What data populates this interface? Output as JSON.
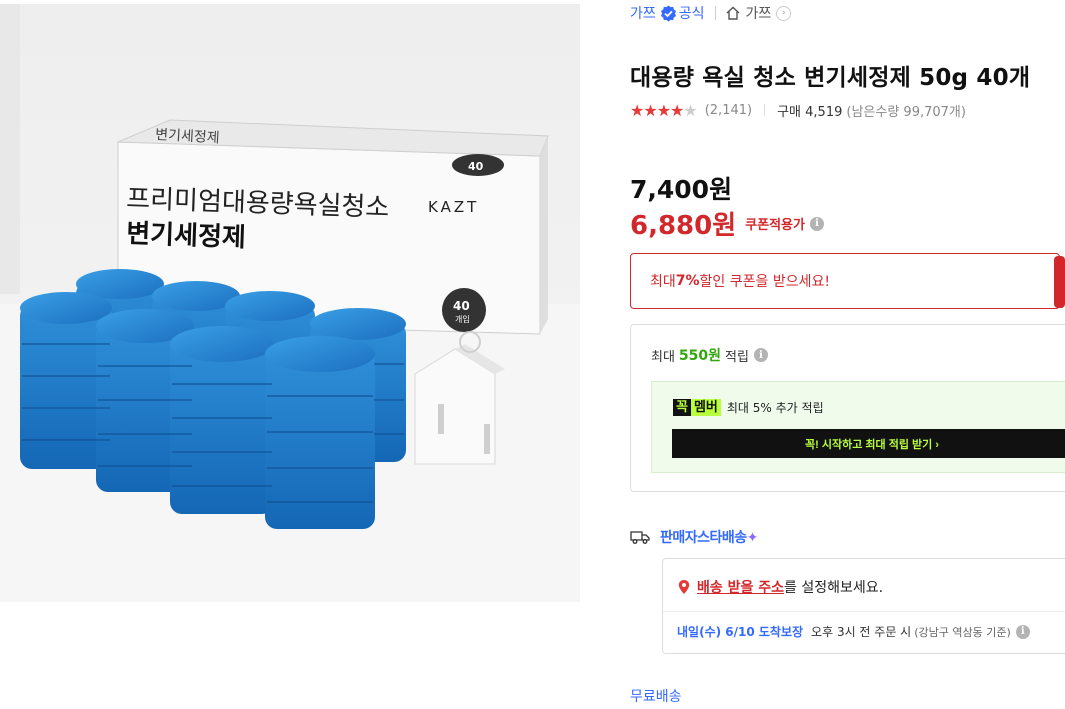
{
  "brand": {
    "name": "가쯔",
    "official_label": "공식",
    "store_name": "가쯔",
    "accent_color": "#346aff"
  },
  "product": {
    "title": "대용량 욕실 청소 변기세정제 50g 40개",
    "rating": 4.5,
    "review_count": "(2,141)",
    "purchase_label": "구매 4,519",
    "remaining_label": "(남은수량 99,707개)",
    "image_alt": "변기세정제 40개입"
  },
  "price": {
    "original": "7,400원",
    "sale": "6,880원",
    "coupon_applied_label": "쿠폰적용가",
    "sale_color": "#d2272b"
  },
  "coupon": {
    "prefix": "최대 ",
    "percent": "7%",
    "suffix": " 할인 쿠폰을 받으세요!"
  },
  "reward": {
    "prefix": "최대",
    "amount": "550원",
    "suffix": "적립",
    "member_logo_left": "꼭",
    "member_logo_right": "멤버",
    "member_benefit": "최대 5% 추가 적립",
    "start_button_label": "꼭! 시작하고 최대 적립 받기 ›",
    "accent_color": "#32a60d"
  },
  "delivery": {
    "seller_star_label": "판매자스타배송",
    "address_link": "배송 받을 주소",
    "address_suffix": "를 설정해보세요.",
    "arrival_date": "내일(수) 6/10 도착보장",
    "arrival_order": "오후 3시 전 주문 시",
    "arrival_area": "(강남구 역삼동 기준)",
    "free_shipping": "무료배송"
  },
  "image_text": {
    "box_title_line1": "프리미엄대용량욕실청소",
    "box_title_line2": "변기세정제",
    "box_brand": "KAZT",
    "badge_count": "40",
    "badge_unit": "개입"
  }
}
